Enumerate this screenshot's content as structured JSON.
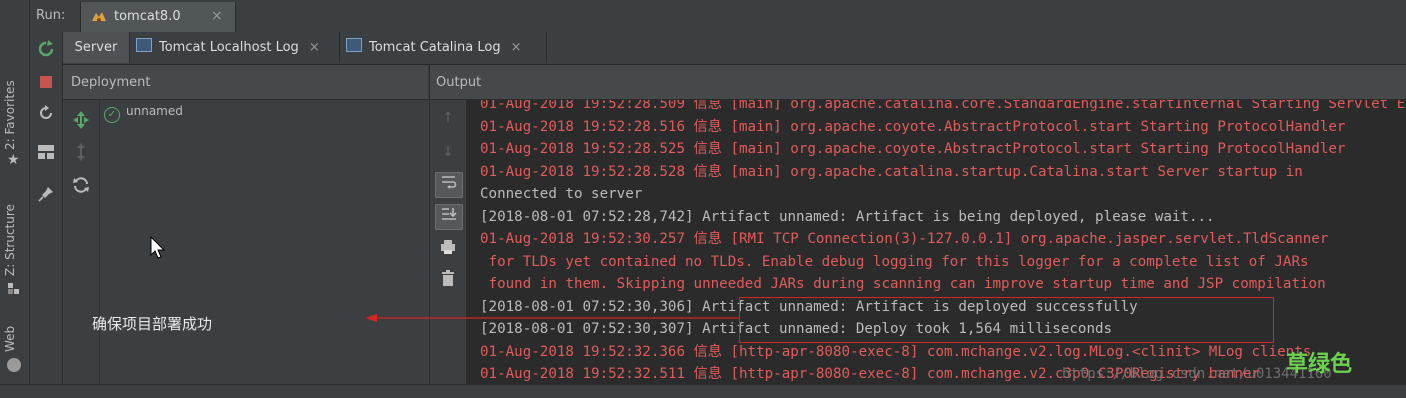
{
  "runbar": {
    "label": "Run:",
    "tab_title": "tomcat8.0",
    "close": "×"
  },
  "leftstrip": {
    "favorites": "2: Favorites",
    "structure": "Z: Structure",
    "web": "Web"
  },
  "tabs": [
    {
      "label": "Server"
    },
    {
      "label": "Tomcat Localhost Log",
      "close": "×"
    },
    {
      "label": "Tomcat Catalina Log",
      "close": "×"
    }
  ],
  "deployment": {
    "header": "Deployment",
    "items": [
      {
        "label": "unnamed",
        "status": "deployed"
      }
    ]
  },
  "output": {
    "header": "Output",
    "lines": [
      {
        "text": "01-Aug-2018 19:52:28.509 信息 [main] org.apache.catalina.core.StandardEngine.startInternal Starting Servlet Engine",
        "color": "red"
      },
      {
        "text": "01-Aug-2018 19:52:28.516 信息 [main] org.apache.coyote.AbstractProtocol.start Starting ProtocolHandler",
        "color": "red"
      },
      {
        "text": "01-Aug-2018 19:52:28.525 信息 [main] org.apache.coyote.AbstractProtocol.start Starting ProtocolHandler",
        "color": "red"
      },
      {
        "text": "01-Aug-2018 19:52:28.528 信息 [main] org.apache.catalina.startup.Catalina.start Server startup in",
        "color": "red"
      },
      {
        "text": "Connected to server",
        "color": "gray"
      },
      {
        "text": "[2018-08-01 07:52:28,742] Artifact unnamed: Artifact is being deployed, please wait...",
        "color": "gray"
      },
      {
        "text": "01-Aug-2018 19:52:30.257 信息 [RMI TCP Connection(3)-127.0.0.1] org.apache.jasper.servlet.TldScanner",
        "color": "red"
      },
      {
        "text": " for TLDs yet contained no TLDs. Enable debug logging for this logger for a complete list of JARs",
        "color": "red"
      },
      {
        "text": " found in them. Skipping unneeded JARs during scanning can improve startup time and JSP compilation",
        "color": "red"
      },
      {
        "text": "[2018-08-01 07:52:30,306] Artifact unnamed: Artifact is deployed successfully",
        "color": "gray"
      },
      {
        "text": "[2018-08-01 07:52:30,307] Artifact unnamed: Deploy took 1,564 milliseconds",
        "color": "gray"
      },
      {
        "text": "01-Aug-2018 19:52:32.366 信息 [http-apr-8080-exec-8] com.mchange.v2.log.MLog.<clinit> MLog clients",
        "color": "red"
      },
      {
        "text": "01-Aug-2018 19:52:32.511 信息 [http-apr-8080-exec-8] com.mchange.v2.c3p0.C3P0Registry banner",
        "color": "red"
      }
    ]
  },
  "annotation": {
    "text": "确保项目部署成功"
  },
  "watermark": {
    "text": "草绿色",
    "url": "https://blog.csdn.net/u013441160"
  },
  "colors": {
    "log_red": "#e05b5b",
    "log_gray": "#bbbbbb",
    "annotation_red": "#d42424",
    "success_green": "#59a869",
    "watermark_green": "#6bd14f"
  }
}
